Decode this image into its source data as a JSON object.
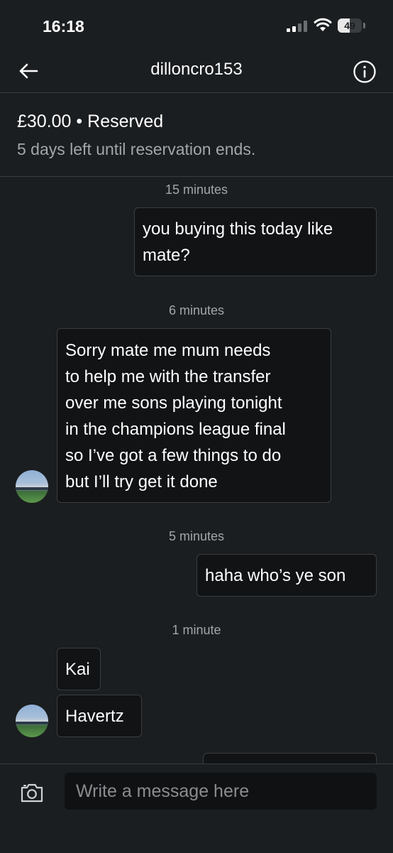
{
  "status_bar": {
    "time": "16:18",
    "battery_level": "49"
  },
  "header": {
    "title": "dilloncro153",
    "back_icon": "arrow-left-icon",
    "info_icon": "info-circle-icon"
  },
  "reservation": {
    "price": "£30.00",
    "separator": "•",
    "status": "Reserved",
    "subtitle": "5 days left until reservation ends."
  },
  "messages": [
    {
      "type": "timestamp",
      "text": "15 minutes"
    },
    {
      "type": "outgoing",
      "lines": [
        "you buying this today like",
        "mate?"
      ]
    },
    {
      "type": "timestamp",
      "text": "6 minutes"
    },
    {
      "type": "incoming",
      "lines": [
        "Sorry mate me mum needs",
        "to help me with the transfer",
        "over me sons playing tonight",
        "in the champions league final",
        "so I’ve got a few things to do",
        "but I’ll try get it done"
      ]
    },
    {
      "type": "timestamp",
      "text": "5 minutes"
    },
    {
      "type": "outgoing",
      "lines": [
        "haha who’s ye son"
      ]
    },
    {
      "type": "timestamp",
      "text": "1 minute"
    },
    {
      "type": "incoming",
      "lines": [
        "Kai"
      ]
    },
    {
      "type": "incoming",
      "lines": [
        "Havertz"
      ]
    },
    {
      "type": "outgoing",
      "lines": [
        ""
      ]
    }
  ],
  "composer": {
    "placeholder": "Write a message here",
    "camera_icon": "camera-icon"
  }
}
